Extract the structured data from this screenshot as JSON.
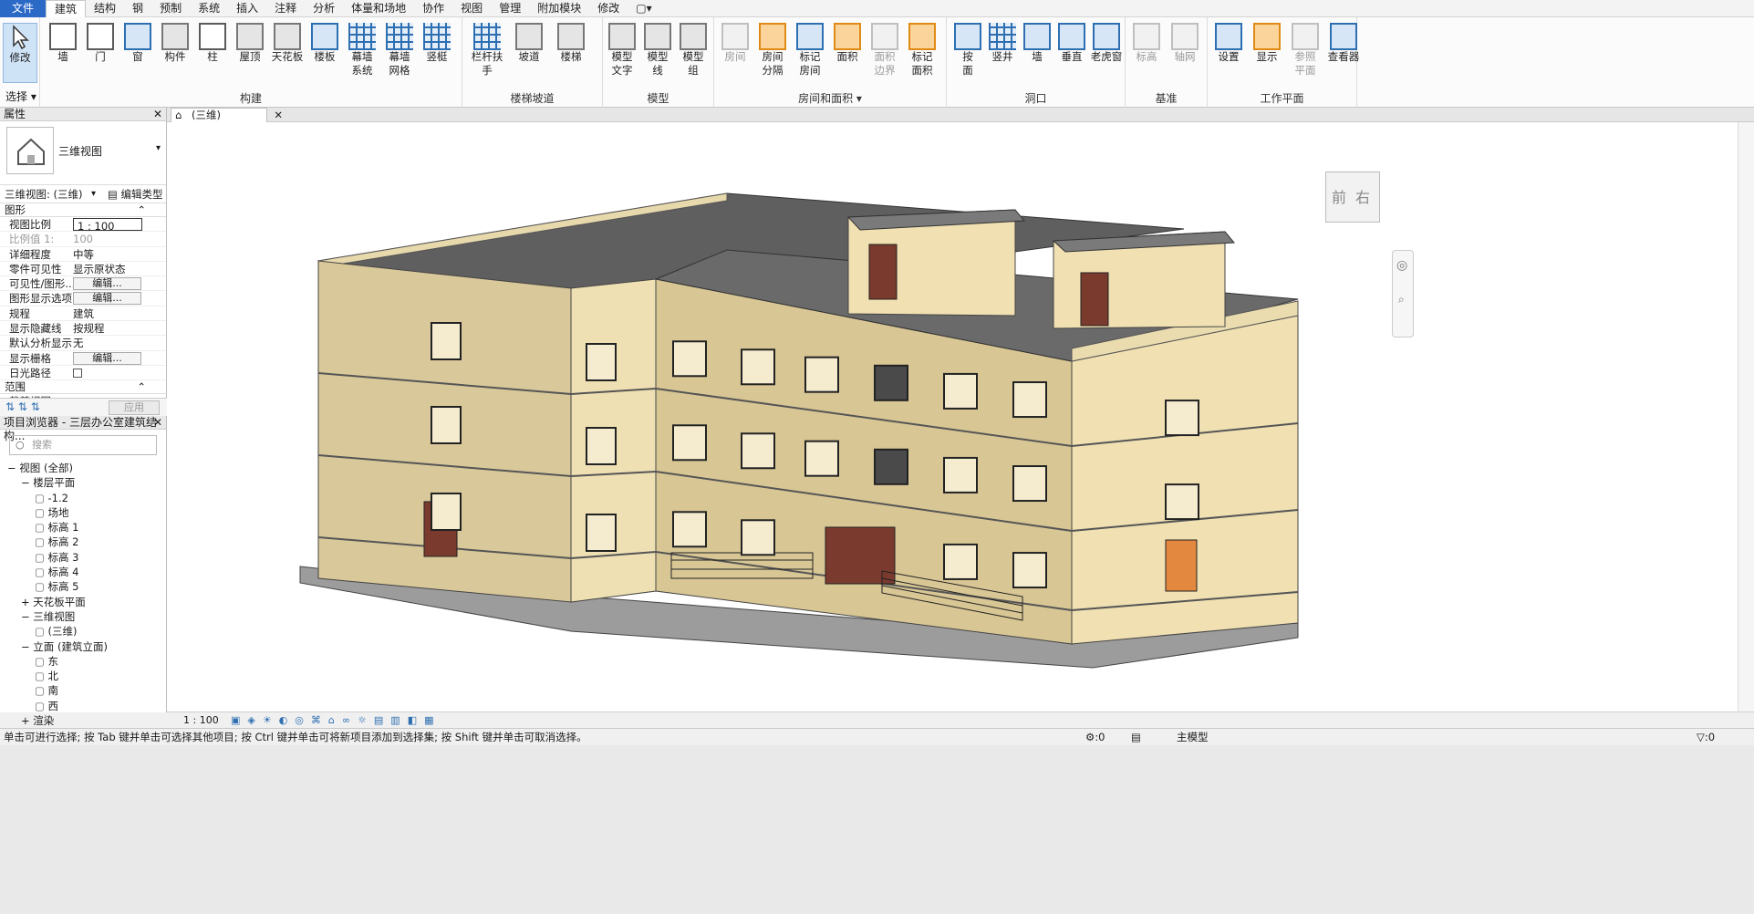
{
  "menu_tabs": [
    "文件",
    "建筑",
    "结构",
    "钢",
    "预制",
    "系统",
    "插入",
    "注释",
    "分析",
    "体量和场地",
    "协作",
    "视图",
    "管理",
    "附加模块",
    "修改",
    "▢▾"
  ],
  "ribbon": {
    "modify": {
      "label": "修改",
      "dropdown": "选择 ▾"
    },
    "build": {
      "title": "构建",
      "tools": [
        "墙",
        "门",
        "窗",
        "构件",
        "柱",
        "屋顶",
        "天花板",
        "楼板",
        "幕墙\n系统",
        "幕墙\n网格",
        "竖梃"
      ]
    },
    "circulation": {
      "title": "楼梯坡道",
      "tools": [
        "栏杆扶手",
        "坡道",
        "楼梯"
      ]
    },
    "model": {
      "title": "模型",
      "tools": [
        "模型\n文字",
        "模型\n线",
        "模型\n组"
      ]
    },
    "room": {
      "title": "房间和面积 ▾",
      "tools": [
        "房间",
        "房间\n分隔",
        "标记\n房间",
        "面积",
        "面积\n边界",
        "标记\n面积"
      ]
    },
    "opening": {
      "title": "洞口",
      "tools": [
        "按\n面",
        "竖井",
        "墙",
        "垂直",
        "老虎窗"
      ]
    },
    "datum": {
      "title": "基准",
      "tools": [
        "标高",
        "轴网"
      ]
    },
    "workplane": {
      "title": "工作平面",
      "tools": [
        "设置",
        "显示",
        "参照\n平面",
        "查看器"
      ]
    }
  },
  "properties": {
    "header": "属性",
    "type_name": "三维视图",
    "view_selector": "三维视图: (三维)",
    "edit_type": "编辑类型",
    "section_graphics": "图形",
    "rows": [
      {
        "k": "视图比例",
        "v": "1 : 100"
      },
      {
        "k": "比例值 1:",
        "v": "100"
      },
      {
        "k": "详细程度",
        "v": "中等"
      },
      {
        "k": "零件可见性",
        "v": "显示原状态"
      },
      {
        "k": "可见性/图形...",
        "v": "编辑..."
      },
      {
        "k": "图形显示选项",
        "v": "编辑..."
      },
      {
        "k": "规程",
        "v": "建筑"
      },
      {
        "k": "显示隐藏线",
        "v": "按规程"
      },
      {
        "k": "默认分析显示...",
        "v": "无"
      },
      {
        "k": "显示栅格",
        "v": "编辑..."
      },
      {
        "k": "日光路径",
        "v": ""
      }
    ],
    "section_extents": "范围",
    "crop_row": "裁剪视图",
    "apply": "应用"
  },
  "browser": {
    "header": "项目浏览器 - 三层办公室建筑结构...",
    "search_placeholder": "搜索",
    "tree": [
      {
        "t": "视图 (全部)",
        "lvl": 0,
        "sign": "−"
      },
      {
        "t": "楼层平面",
        "lvl": 1,
        "sign": "−"
      },
      {
        "t": "-1.2",
        "lvl": 2
      },
      {
        "t": "场地",
        "lvl": 2
      },
      {
        "t": "标高 1",
        "lvl": 2
      },
      {
        "t": "标高 2",
        "lvl": 2
      },
      {
        "t": "标高 3",
        "lvl": 2
      },
      {
        "t": "标高 4",
        "lvl": 2
      },
      {
        "t": "标高 5",
        "lvl": 2
      },
      {
        "t": "天花板平面",
        "lvl": 1,
        "sign": "+"
      },
      {
        "t": "三维视图",
        "lvl": 1,
        "sign": "−"
      },
      {
        "t": "(三维)",
        "lvl": 2
      },
      {
        "t": "立面 (建筑立面)",
        "lvl": 1,
        "sign": "−"
      },
      {
        "t": "东",
        "lvl": 2
      },
      {
        "t": "北",
        "lvl": 2
      },
      {
        "t": "南",
        "lvl": 2
      },
      {
        "t": "西",
        "lvl": 2
      },
      {
        "t": "渲染",
        "lvl": 1,
        "sign": "+"
      }
    ]
  },
  "view_tab": "(三维)",
  "viewcube": {
    "front": "前",
    "right": "右"
  },
  "view_scale": "1 : 100",
  "status": {
    "hint": "单击可进行选择; 按 Tab 键并单击可选择其他项目; 按 Ctrl 键并单击可将新项目添加到选择集; 按 Shift 键并单击可取消选择。",
    "zero": ":0",
    "model": "主模型",
    "filter": ":0"
  }
}
